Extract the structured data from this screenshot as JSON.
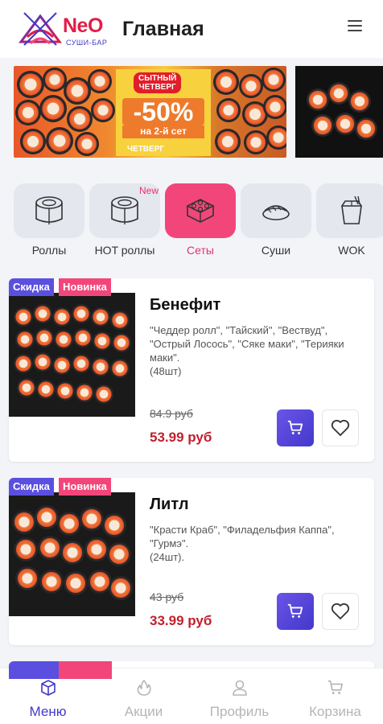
{
  "header": {
    "logo_text": "NeO",
    "logo_subtext": "СУШИ-БАР",
    "title": "Главная"
  },
  "categories": [
    {
      "label": "Роллы",
      "badge": "",
      "active": false
    },
    {
      "label": "HOT роллы",
      "badge": "New",
      "active": false
    },
    {
      "label": "Сеты",
      "badge": "",
      "active": true
    },
    {
      "label": "Суши",
      "badge": "",
      "active": false
    },
    {
      "label": "WOK",
      "badge": "",
      "active": false
    }
  ],
  "promo": {
    "tag_line1": "СЫТНЫЙ",
    "tag_line2": "ЧЕТВЕРГ",
    "discount": "-50%",
    "note": "на 2-й сет",
    "day": "ЧЕТВЕРГ"
  },
  "products": [
    {
      "badge_sale": "Скидка",
      "badge_new": "Новинка",
      "title": "Бенефит",
      "description": "\"Чеддер ролл\", \"Тайский\", \"Вествуд\", \"Острый Лосось\", \"Сяке маки\", \"Терияки маки\".\n(48шт)",
      "price_old": "84.9 руб",
      "price_new": "53.99 руб"
    },
    {
      "badge_sale": "Скидка",
      "badge_new": "Новинка",
      "title": "Литл",
      "description": "\"Красти Краб\", \"Филадельфия Каппа\", \"Гурмэ\".\n(24шт).",
      "price_old": "43 руб",
      "price_new": "33.99 руб"
    }
  ],
  "bottom_nav": [
    {
      "label": "Меню",
      "icon": "menu-cube-icon",
      "active": true
    },
    {
      "label": "Акции",
      "icon": "flame-icon",
      "active": false
    },
    {
      "label": "Профиль",
      "icon": "user-icon",
      "active": false
    },
    {
      "label": "Корзина",
      "icon": "cart-icon",
      "active": false
    }
  ],
  "colors": {
    "accent": "#4338ca",
    "pink": "#f2467a",
    "price": "#c0202d"
  }
}
